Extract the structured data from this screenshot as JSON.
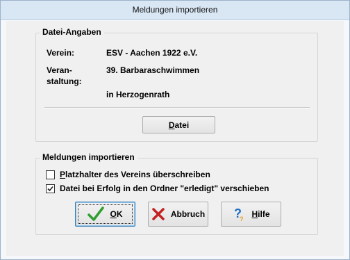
{
  "window": {
    "title": "Meldungen importieren"
  },
  "datei_angaben": {
    "group_title": "Datei-Angaben",
    "verein_label": "Verein:",
    "verein_value": "ESV - Aachen 1922 e.V.",
    "veranstaltung_label_line1": "Veran-",
    "veranstaltung_label_line2": "staltung:",
    "veranstaltung_value": "39. Barbaraschwimmen",
    "ort_value": "in Herzogenrath",
    "datei_button": {
      "mnemonic": "D",
      "rest": "atei"
    }
  },
  "meldungen": {
    "group_title": "Meldungen importieren",
    "options": [
      {
        "mnemonic": "P",
        "rest": "latzhalter des Vereins überschreiben",
        "checked": false
      },
      {
        "mnemonic": "",
        "rest": "Datei bei Erfolg in den Ordner \"erledigt\" verschieben",
        "checked": true
      }
    ]
  },
  "buttons": {
    "ok": {
      "mnemonic": "O",
      "rest": "K",
      "icon": "checkmark-icon",
      "color": "#2f9e2f"
    },
    "abbruch": {
      "label": "Abbruch",
      "icon": "cross-icon",
      "color": "#c41e1e"
    },
    "hilfe": {
      "mnemonic": "H",
      "rest": "ilfe",
      "icon": "question-icon",
      "color": "#1e6fc4"
    }
  }
}
